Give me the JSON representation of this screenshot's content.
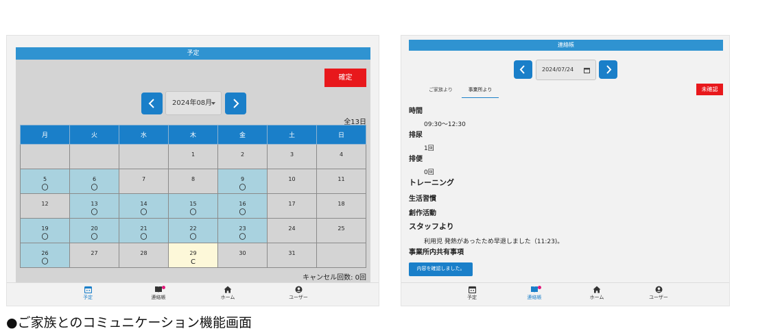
{
  "left": {
    "header_title": "予定",
    "confirm_label": "確定",
    "month": "2024年08月",
    "total": "全13日",
    "weekdays": [
      "月",
      "火",
      "水",
      "木",
      "金",
      "土",
      "日"
    ],
    "weeks": [
      [
        {
          "day": "",
          "mark": "",
          "state": "gray"
        },
        {
          "day": "",
          "mark": "",
          "state": "gray"
        },
        {
          "day": "",
          "mark": "",
          "state": "gray"
        },
        {
          "day": "1",
          "mark": "",
          "state": "gray"
        },
        {
          "day": "2",
          "mark": "",
          "state": "gray"
        },
        {
          "day": "3",
          "mark": "",
          "state": "gray"
        },
        {
          "day": "4",
          "mark": "",
          "state": "gray"
        }
      ],
      [
        {
          "day": "5",
          "mark": "〇",
          "state": "blue"
        },
        {
          "day": "6",
          "mark": "〇",
          "state": "blue"
        },
        {
          "day": "7",
          "mark": "",
          "state": "gray"
        },
        {
          "day": "8",
          "mark": "",
          "state": "gray"
        },
        {
          "day": "9",
          "mark": "〇",
          "state": "blue"
        },
        {
          "day": "10",
          "mark": "",
          "state": "gray"
        },
        {
          "day": "11",
          "mark": "",
          "state": "gray"
        }
      ],
      [
        {
          "day": "12",
          "mark": "",
          "state": "gray"
        },
        {
          "day": "13",
          "mark": "〇",
          "state": "blue"
        },
        {
          "day": "14",
          "mark": "〇",
          "state": "blue"
        },
        {
          "day": "15",
          "mark": "〇",
          "state": "blue"
        },
        {
          "day": "16",
          "mark": "〇",
          "state": "blue"
        },
        {
          "day": "17",
          "mark": "",
          "state": "gray"
        },
        {
          "day": "18",
          "mark": "",
          "state": "gray"
        }
      ],
      [
        {
          "day": "19",
          "mark": "〇",
          "state": "blue"
        },
        {
          "day": "20",
          "mark": "〇",
          "state": "blue"
        },
        {
          "day": "21",
          "mark": "〇",
          "state": "blue"
        },
        {
          "day": "22",
          "mark": "〇",
          "state": "blue"
        },
        {
          "day": "23",
          "mark": "〇",
          "state": "blue"
        },
        {
          "day": "24",
          "mark": "",
          "state": "gray"
        },
        {
          "day": "25",
          "mark": "",
          "state": "gray"
        }
      ],
      [
        {
          "day": "26",
          "mark": "〇",
          "state": "blue"
        },
        {
          "day": "27",
          "mark": "",
          "state": "gray"
        },
        {
          "day": "28",
          "mark": "",
          "state": "gray"
        },
        {
          "day": "29",
          "mark": "C",
          "state": "yellow"
        },
        {
          "day": "30",
          "mark": "",
          "state": "gray"
        },
        {
          "day": "31",
          "mark": "",
          "state": "gray"
        },
        {
          "day": "",
          "mark": "",
          "state": "gray"
        }
      ]
    ],
    "cancel_count": "キャンセル回数: 0回",
    "nav": [
      {
        "label": "予定",
        "icon": "calendar-icon",
        "active": true,
        "badge": false
      },
      {
        "label": "連絡帳",
        "icon": "book-icon",
        "active": false,
        "badge": true
      },
      {
        "label": "ホーム",
        "icon": "home-icon",
        "active": false,
        "badge": false
      },
      {
        "label": "ユーザー",
        "icon": "user-icon",
        "active": false,
        "badge": false
      }
    ]
  },
  "right": {
    "header_title": "連絡帳",
    "date": "2024/07/24",
    "tabs": [
      "ご家族より",
      "事業所より"
    ],
    "active_tab": 1,
    "status": "未確認",
    "sections": {
      "time_title": "時間",
      "time_value": "09:30〜12:30",
      "urination_title": "排尿",
      "urination_value": "1回",
      "defecation_title": "排便",
      "defecation_value": "0回",
      "training_title": "トレーニング",
      "habits_title": "生活習慣",
      "creative_title": "創作活動",
      "staff_title": "スタッフより",
      "staff_value": "利用児 発熱があったため早退しました（11:23)。",
      "shared_title": "事業所内共有事項"
    },
    "confirm_button": "内容を確認しました。",
    "nav": [
      {
        "label": "予定",
        "icon": "calendar-icon",
        "active": false,
        "badge": false
      },
      {
        "label": "連絡帳",
        "icon": "book-icon",
        "active": true,
        "badge": true
      },
      {
        "label": "ホーム",
        "icon": "home-icon",
        "active": false,
        "badge": false
      },
      {
        "label": "ユーザー",
        "icon": "user-icon",
        "active": false,
        "badge": false
      }
    ]
  },
  "caption": "●ご家族とのコミュニケーション機能画面",
  "colors": {
    "accent": "#1a7fc9",
    "header": "#2f93d1",
    "danger": "#e8181c",
    "attend": "#a9d2df",
    "cancel": "#fdf8d9",
    "badge": "#e0197a"
  }
}
